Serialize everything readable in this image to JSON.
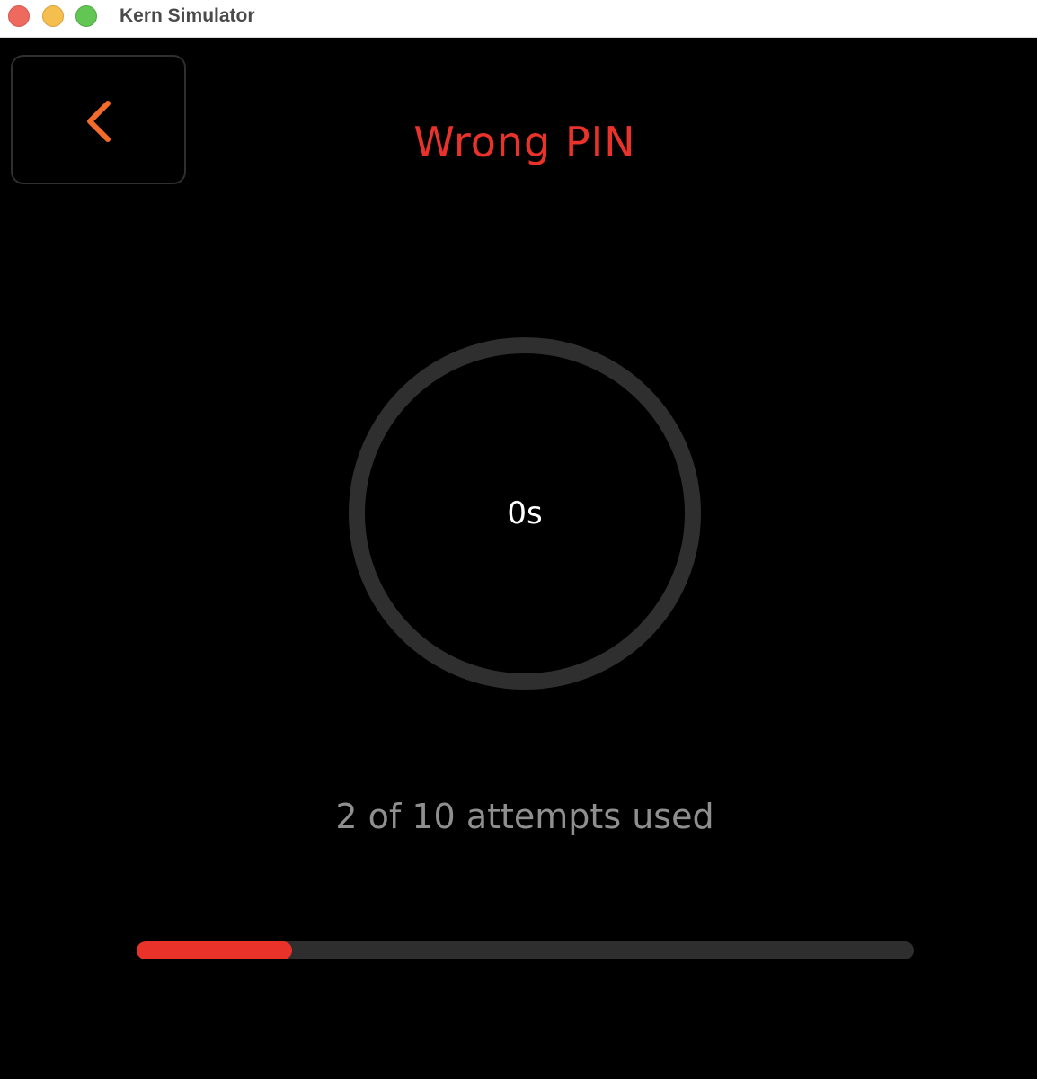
{
  "window": {
    "title": "Kern Simulator"
  },
  "header": {
    "back_icon": "chevron-left-icon",
    "title": "Wrong PIN"
  },
  "countdown": {
    "label": "0s",
    "progress": 0
  },
  "attempts": {
    "text": "2 of 10 attempts used",
    "used": 2,
    "total": 10
  },
  "colors": {
    "title": "#e8322a",
    "accent": "#f26b2b",
    "progress_fill": "#e8322a",
    "progress_track": "#2e2e2e",
    "ring": "#2f2f2f"
  }
}
